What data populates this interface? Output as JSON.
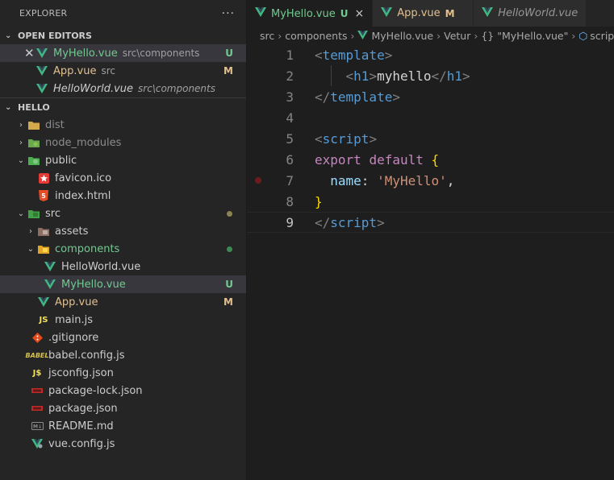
{
  "explorer": {
    "title": "EXPLORER",
    "more": "···",
    "open_editors": {
      "header": "OPEN EDITORS",
      "items": [
        {
          "name": "MyHello.vue",
          "path": "src\\components",
          "status": "U"
        },
        {
          "name": "App.vue",
          "path": "src",
          "status": "M"
        },
        {
          "name": "HelloWorld.vue",
          "path": "src\\components",
          "status": ""
        }
      ]
    },
    "project": {
      "header": "HELLO",
      "items": [
        {
          "label": "dist"
        },
        {
          "label": "node_modules"
        },
        {
          "label": "public"
        },
        {
          "label": "favicon.ico"
        },
        {
          "label": "index.html"
        },
        {
          "label": "src"
        },
        {
          "label": "assets"
        },
        {
          "label": "components"
        },
        {
          "label": "HelloWorld.vue"
        },
        {
          "label": "MyHello.vue",
          "status": "U"
        },
        {
          "label": "App.vue",
          "status": "M"
        },
        {
          "label": "main.js"
        },
        {
          "label": ".gitignore"
        },
        {
          "label": "babel.config.js"
        },
        {
          "label": "jsconfig.json"
        },
        {
          "label": "package-lock.json"
        },
        {
          "label": "package.json"
        },
        {
          "label": "README.md"
        },
        {
          "label": "vue.config.js"
        }
      ]
    }
  },
  "tabs": [
    {
      "label": "MyHello.vue",
      "status": "U",
      "close": "×"
    },
    {
      "label": "App.vue",
      "status": "M"
    },
    {
      "label": "HelloWorld.vue"
    }
  ],
  "breadcrumb": [
    "src",
    "components",
    "MyHello.vue",
    "Vetur",
    "{} \"MyHello.vue\"",
    "script"
  ],
  "editor": {
    "line_numbers": [
      "1",
      "2",
      "3",
      "4",
      "5",
      "6",
      "7",
      "8",
      "9"
    ],
    "tokens": {
      "l1_open": "<",
      "l1_tag": "template",
      "l1_close": ">",
      "l2_open": "<",
      "l2_tag": "h1",
      "l2_close": ">",
      "l2_text": "myhello",
      "l2_eopen": "</",
      "l2_etag": "h1",
      "l2_eclose": ">",
      "l3_open": "</",
      "l3_tag": "template",
      "l3_close": ">",
      "l5_open": "<",
      "l5_tag": "script",
      "l5_close": ">",
      "l6_kw1": "export",
      "l6_kw2": "default",
      "l6_brace": "{",
      "l7_prop": "name",
      "l7_colon": ":",
      "l7_str": "'MyHello'",
      "l7_comma": ",",
      "l8_brace": "}",
      "l9_open": "</",
      "l9_tag": "script",
      "l9_close": ">"
    }
  },
  "colors": {
    "vue_green": "#41b883",
    "vue_dark": "#35495e",
    "untracked": "#73c991",
    "modified": "#e2c08d"
  }
}
